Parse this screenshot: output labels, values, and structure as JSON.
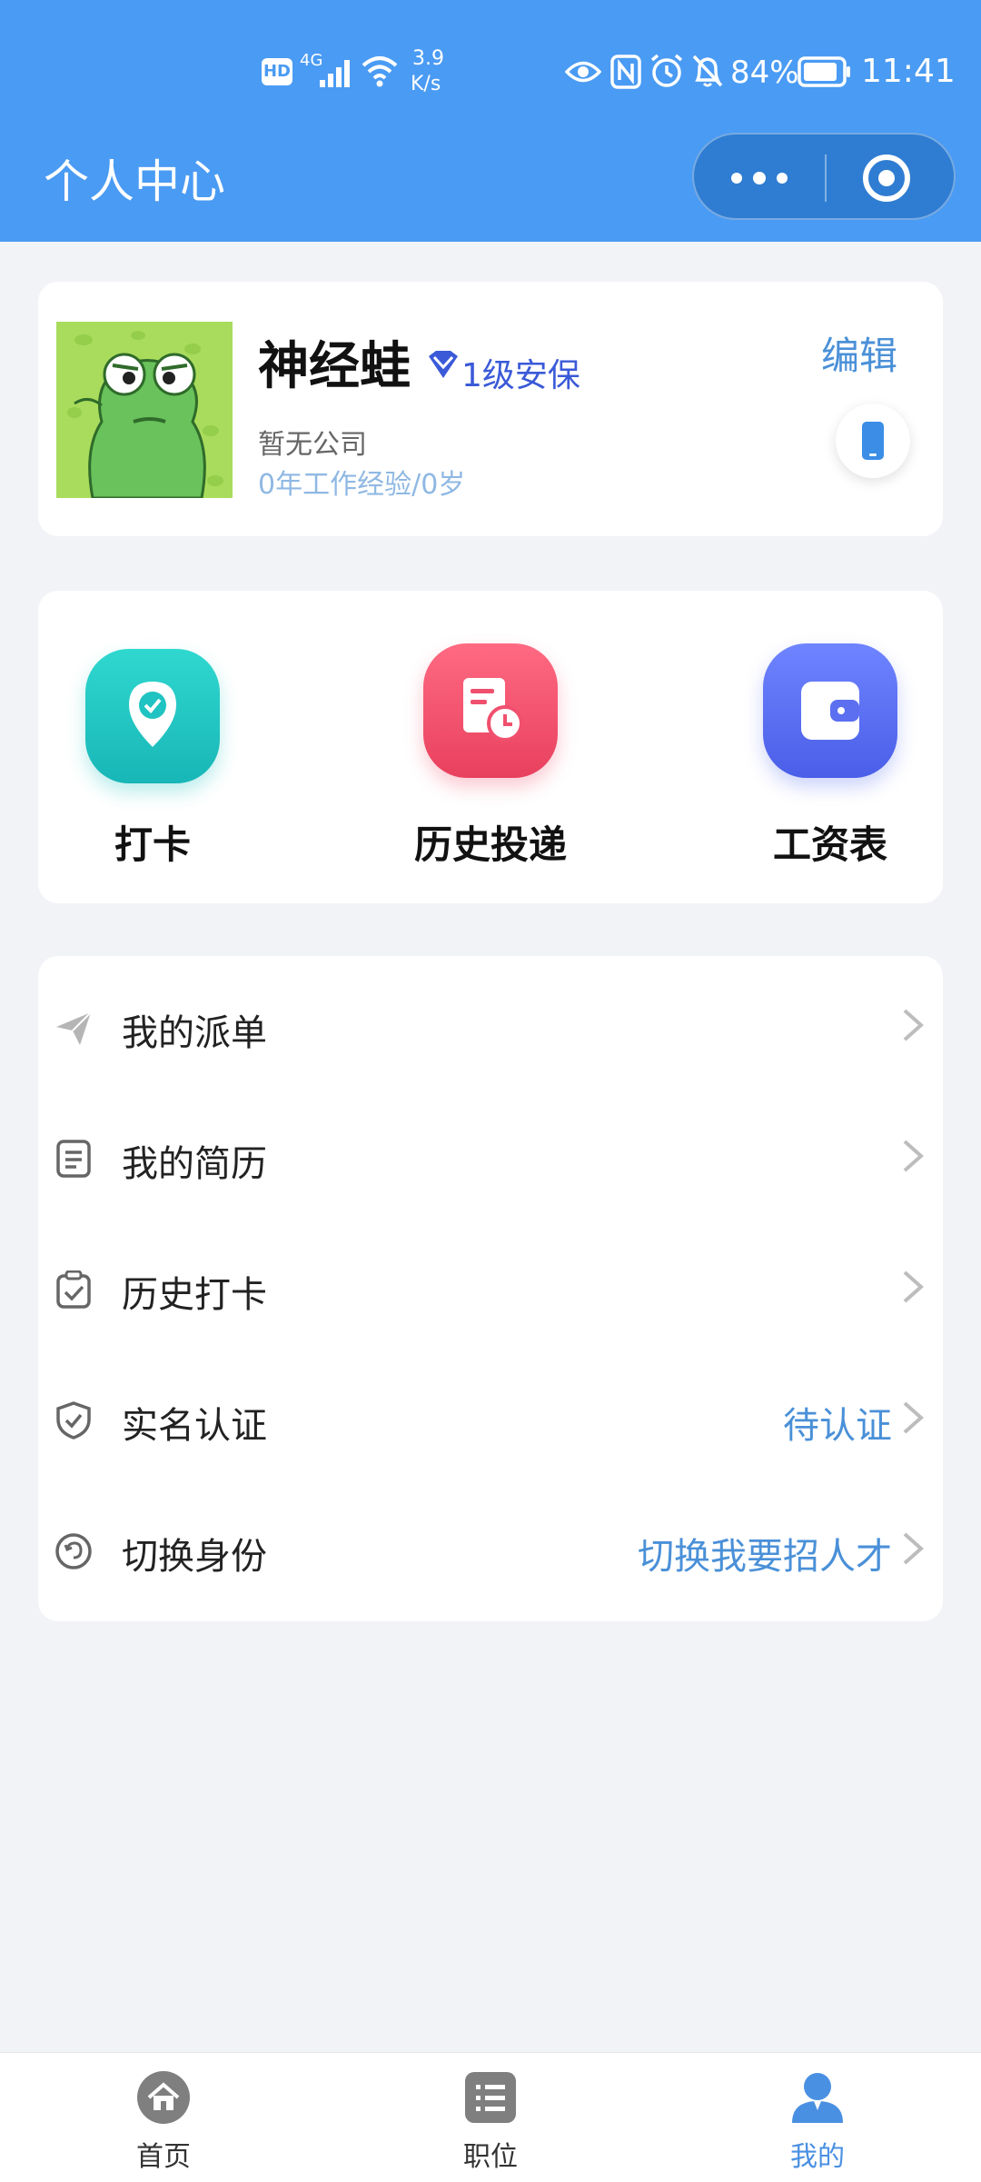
{
  "status_bar": {
    "hd": "HD",
    "network": "4G",
    "speed_value": "3.9",
    "speed_unit": "K/s",
    "battery": "84%",
    "time": "11:41"
  },
  "header": {
    "title": "个人中心"
  },
  "profile": {
    "name": "神经蛙",
    "badge": "1级安保",
    "edit_label": "编辑",
    "company": "暂无公司",
    "experience": "0年工作经验/0岁"
  },
  "quick_actions": [
    {
      "label": "打卡",
      "icon": "location-check-icon",
      "color": "#1fc3c1"
    },
    {
      "label": "历史投递",
      "icon": "document-clock-icon",
      "color": "#f0506e"
    },
    {
      "label": "工资表",
      "icon": "wallet-icon",
      "color": "#5b6ff0"
    }
  ],
  "menu": [
    {
      "label": "我的派单",
      "status": "",
      "icon": "paper-plane-icon"
    },
    {
      "label": "我的简历",
      "status": "",
      "icon": "document-icon"
    },
    {
      "label": "历史打卡",
      "status": "",
      "icon": "clipboard-check-icon"
    },
    {
      "label": "实名认证",
      "status": "待认证",
      "icon": "shield-check-icon"
    },
    {
      "label": "切换身份",
      "status": "切换我要招人才",
      "icon": "switch-icon"
    }
  ],
  "tabbar": [
    {
      "label": "首页",
      "icon": "home-icon",
      "active": false
    },
    {
      "label": "职位",
      "icon": "list-icon",
      "active": false
    },
    {
      "label": "我的",
      "icon": "user-icon",
      "active": true
    }
  ],
  "colors": {
    "primary": "#4a9bf3",
    "active_tab": "#4a90e2",
    "link": "#4a90d8"
  }
}
